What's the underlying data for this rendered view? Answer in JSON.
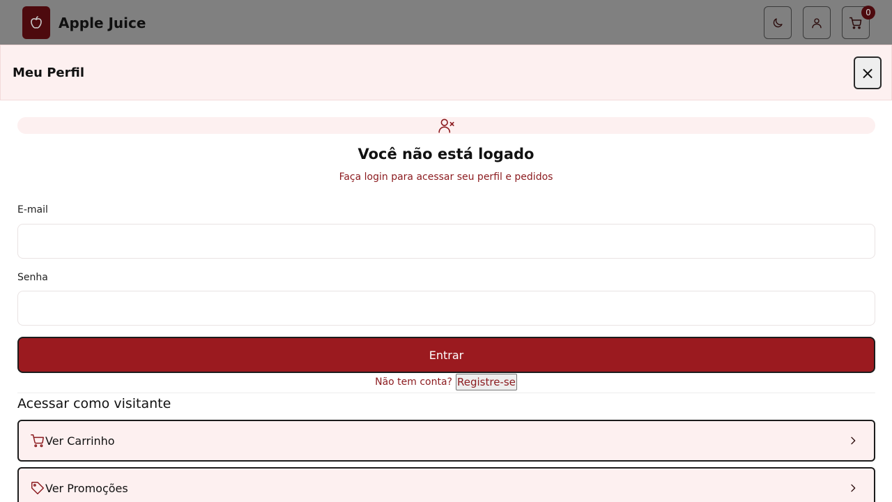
{
  "header": {
    "brand": "Apple Juice",
    "cart_count": "0",
    "icons": [
      "apple-icon",
      "moon-icon",
      "user-icon",
      "cart-icon"
    ]
  },
  "profile_panel": {
    "title": "Meu Perfil",
    "close_label": "×",
    "status_icon": "user-x-icon",
    "heading": "Você não está logado",
    "subheading": "Faça login para acessar seu perfil e pedidos"
  },
  "login_form": {
    "email_label": "E-mail",
    "email_value": "",
    "password_label": "Senha",
    "password_value": "",
    "submit_label": "Entrar",
    "register_question": "Não tem conta?",
    "register_link": "Registre-se"
  },
  "guest": {
    "title": "Acessar como visitante",
    "items": [
      {
        "label": "Ver Carrinho",
        "icon": "cart-icon"
      },
      {
        "label": "Ver Promoções",
        "icon": "tag-icon"
      }
    ]
  },
  "colors": {
    "accent": "#9b1a1f",
    "accent_text": "#8b1a1e",
    "soft_bg": "#fdf0f0",
    "overlay": "#808080"
  }
}
